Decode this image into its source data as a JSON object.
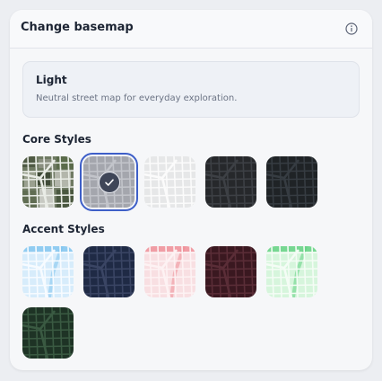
{
  "header": {
    "title": "Change basemap",
    "info_icon": "info-icon"
  },
  "current_style": {
    "name": "Light",
    "description": "Neutral street map for everyday exploration."
  },
  "sections": {
    "core_label": "Core Styles",
    "accent_label": "Accent Styles"
  },
  "core_styles": [
    {
      "id": "satellite",
      "bg": "#6f7a63",
      "line": "#e9ece6",
      "pattern": "sat",
      "selected": false
    },
    {
      "id": "light",
      "bg": "#a4a6ad",
      "line": "#c2c4ca",
      "pattern": "grid",
      "selected": true
    },
    {
      "id": "light-gray",
      "bg": "#e6e7e8",
      "line": "#fbfbfb",
      "pattern": "grid",
      "selected": false
    },
    {
      "id": "dark",
      "bg": "#26282b",
      "line": "#3d4045",
      "pattern": "grid",
      "selected": false
    },
    {
      "id": "dark-slate",
      "bg": "#1f2326",
      "line": "#363c42",
      "pattern": "grid",
      "selected": false
    }
  ],
  "accent_styles": [
    {
      "id": "sky",
      "bg": "#d7ecfb",
      "line": "#f7fbff",
      "pattern": "grid",
      "accent": "#7fc4ef",
      "selected": false
    },
    {
      "id": "navy",
      "bg": "#1f2a45",
      "line": "#3a4564",
      "pattern": "grid",
      "selected": false
    },
    {
      "id": "blush",
      "bg": "#f8dfe2",
      "line": "#fdf2f3",
      "pattern": "grid",
      "accent": "#ee8c96",
      "selected": false
    },
    {
      "id": "maroon",
      "bg": "#3a1820",
      "line": "#5a2d37",
      "pattern": "grid",
      "selected": false
    },
    {
      "id": "mint",
      "bg": "#d6f5dc",
      "line": "#f4fcf5",
      "pattern": "grid",
      "accent": "#5fcf7f",
      "selected": false
    },
    {
      "id": "forest",
      "bg": "#1e3325",
      "line": "#3a5a42",
      "pattern": "grid",
      "selected": false
    }
  ]
}
